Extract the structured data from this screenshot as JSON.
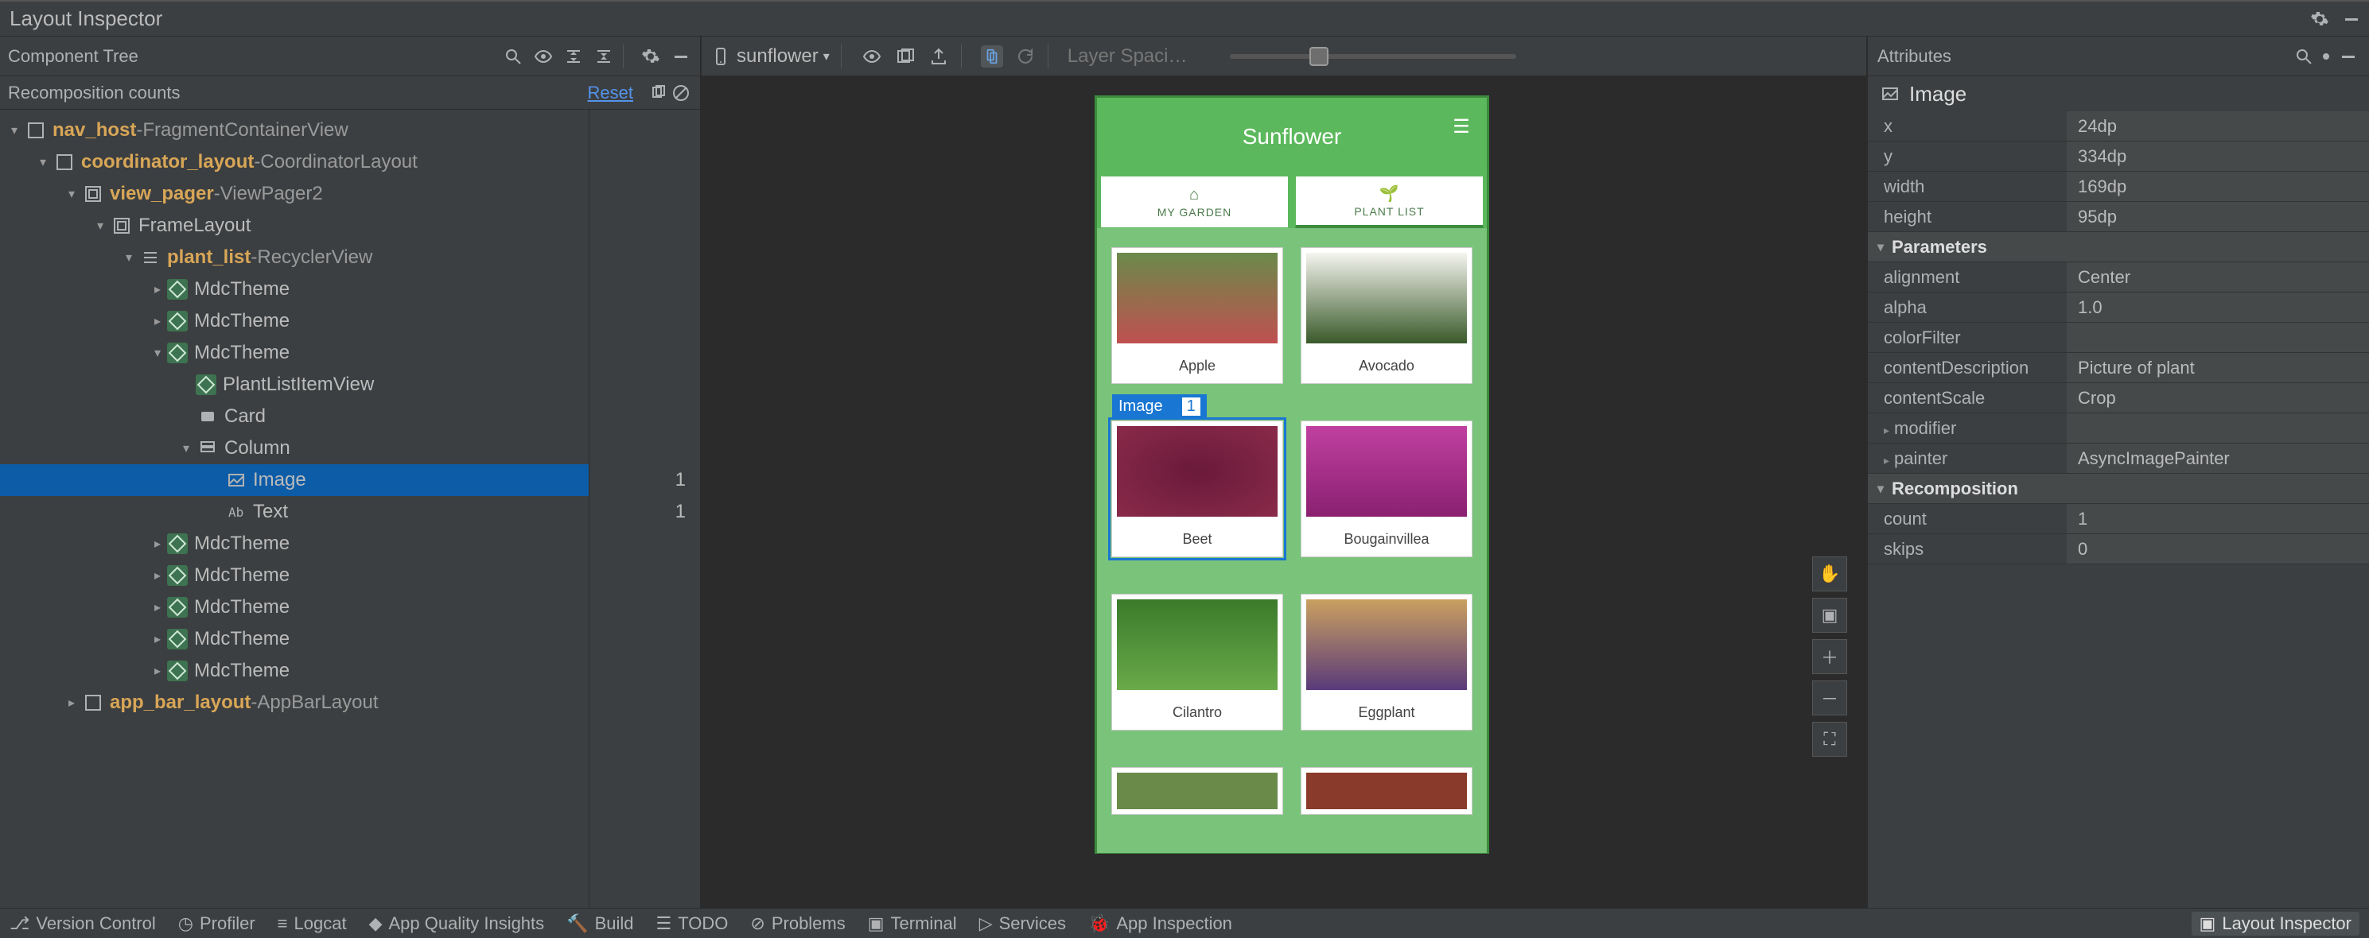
{
  "title_bar": {
    "title": "Layout Inspector"
  },
  "left": {
    "toolbar_label": "Component Tree",
    "subhead_label": "Recomposition counts",
    "reset_label": "Reset"
  },
  "tree": [
    {
      "depth": 0,
      "arrow": "open",
      "icon": "container",
      "id": "nav_host",
      "cls": "FragmentContainerView"
    },
    {
      "depth": 1,
      "arrow": "open",
      "icon": "container",
      "id": "coordinator_layout",
      "cls": "CoordinatorLayout"
    },
    {
      "depth": 2,
      "arrow": "open",
      "icon": "viewgroup",
      "id": "view_pager",
      "cls": "ViewPager2"
    },
    {
      "depth": 3,
      "arrow": "open",
      "icon": "viewgroup",
      "id_plain": "FrameLayout"
    },
    {
      "depth": 4,
      "arrow": "open",
      "icon": "list",
      "id": "plant_list",
      "cls": "RecyclerView"
    },
    {
      "depth": 5,
      "arrow": "closed",
      "icon": "compose",
      "id_plain": "MdcTheme"
    },
    {
      "depth": 5,
      "arrow": "closed",
      "icon": "compose",
      "id_plain": "MdcTheme"
    },
    {
      "depth": 5,
      "arrow": "open",
      "icon": "compose",
      "id_plain": "MdcTheme"
    },
    {
      "depth": 6,
      "arrow": "none",
      "icon": "compose",
      "id_plain": "PlantListItemView"
    },
    {
      "depth": 6,
      "arrow": "none",
      "icon": "card",
      "id_plain": "Card"
    },
    {
      "depth": 6,
      "arrow": "open",
      "icon": "column",
      "id_plain": "Column"
    },
    {
      "depth": 7,
      "arrow": "none",
      "icon": "image",
      "id_plain": "Image",
      "selected": true,
      "count": "1"
    },
    {
      "depth": 7,
      "arrow": "none",
      "icon": "text",
      "id_plain": "Text",
      "count": "1"
    },
    {
      "depth": 5,
      "arrow": "closed",
      "icon": "compose",
      "id_plain": "MdcTheme"
    },
    {
      "depth": 5,
      "arrow": "closed",
      "icon": "compose",
      "id_plain": "MdcTheme"
    },
    {
      "depth": 5,
      "arrow": "closed",
      "icon": "compose",
      "id_plain": "MdcTheme"
    },
    {
      "depth": 5,
      "arrow": "closed",
      "icon": "compose",
      "id_plain": "MdcTheme"
    },
    {
      "depth": 5,
      "arrow": "closed",
      "icon": "compose",
      "id_plain": "MdcTheme"
    },
    {
      "depth": 2,
      "arrow": "closed",
      "icon": "container",
      "id": "app_bar_layout",
      "cls": "AppBarLayout"
    }
  ],
  "center": {
    "device": "sunflower",
    "layer_label": "Layer Spaci…",
    "phone": {
      "title": "Sunflower",
      "tabs": [
        "MY GARDEN",
        "PLANT LIST"
      ],
      "badge": "Image",
      "badge_count": "1",
      "plants": [
        "Apple",
        "Avocado",
        "Beet",
        "Bougainvillea",
        "Cilantro",
        "Eggplant"
      ]
    }
  },
  "attributes": {
    "panel_label": "Attributes",
    "selected": "Image",
    "rows": [
      {
        "k": "x",
        "v": "24dp"
      },
      {
        "k": "y",
        "v": "334dp"
      },
      {
        "k": "width",
        "v": "169dp"
      },
      {
        "k": "height",
        "v": "95dp"
      }
    ],
    "section_params": "Parameters",
    "param_rows": [
      {
        "k": "alignment",
        "v": "Center"
      },
      {
        "k": "alpha",
        "v": "1.0"
      },
      {
        "k": "colorFilter",
        "v": ""
      },
      {
        "k": "contentDescription",
        "v": "Picture of plant"
      },
      {
        "k": "contentScale",
        "v": "Crop"
      },
      {
        "k": "modifier",
        "v": "",
        "nestable": true
      },
      {
        "k": "painter",
        "v": "AsyncImagePainter",
        "nestable": true
      }
    ],
    "section_recomp": "Recomposition",
    "recomp_rows": [
      {
        "k": "count",
        "v": "1"
      },
      {
        "k": "skips",
        "v": "0"
      }
    ]
  },
  "bottom": {
    "items": [
      "Version Control",
      "Profiler",
      "Logcat",
      "App Quality Insights",
      "Build",
      "TODO",
      "Problems",
      "Terminal",
      "Services",
      "App Inspection"
    ],
    "active": "Layout Inspector"
  }
}
